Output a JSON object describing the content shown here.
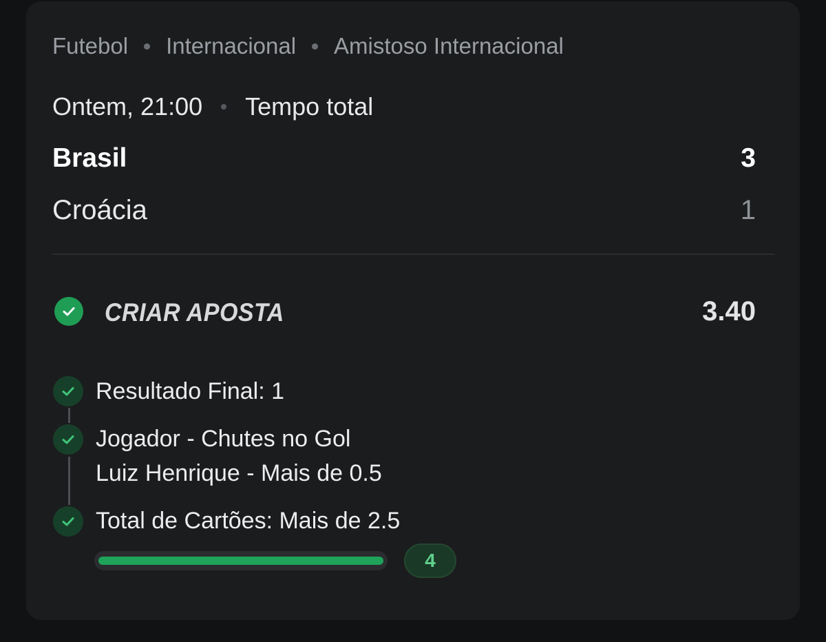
{
  "breadcrumb": {
    "sport": "Futebol",
    "region": "Internacional",
    "competition": "Amistoso Internacional"
  },
  "match": {
    "time": "Ontem, 21:00",
    "period": "Tempo total",
    "home": {
      "name": "Brasil",
      "score": "3"
    },
    "away": {
      "name": "Croácia",
      "score": "1"
    }
  },
  "bet": {
    "title": "CRIAR APOSTA",
    "odds": "3.40",
    "status_icon": "check-circle-icon",
    "legs": [
      {
        "line1": "Resultado Final: 1"
      },
      {
        "line1": "Jogador - Chutes no Gol",
        "line2": "Luiz Henrique - Mais de 0.5"
      },
      {
        "line1": "Total de Cartões: Mais de 2.5"
      }
    ],
    "progress": {
      "fraction": 1.0,
      "count": "4"
    }
  },
  "colors": {
    "background": "#111213",
    "card": "#1b1c1e",
    "accent_green": "#1f9d55",
    "leg_check_bg": "#17402a",
    "muted_text": "#9a9ea3"
  }
}
